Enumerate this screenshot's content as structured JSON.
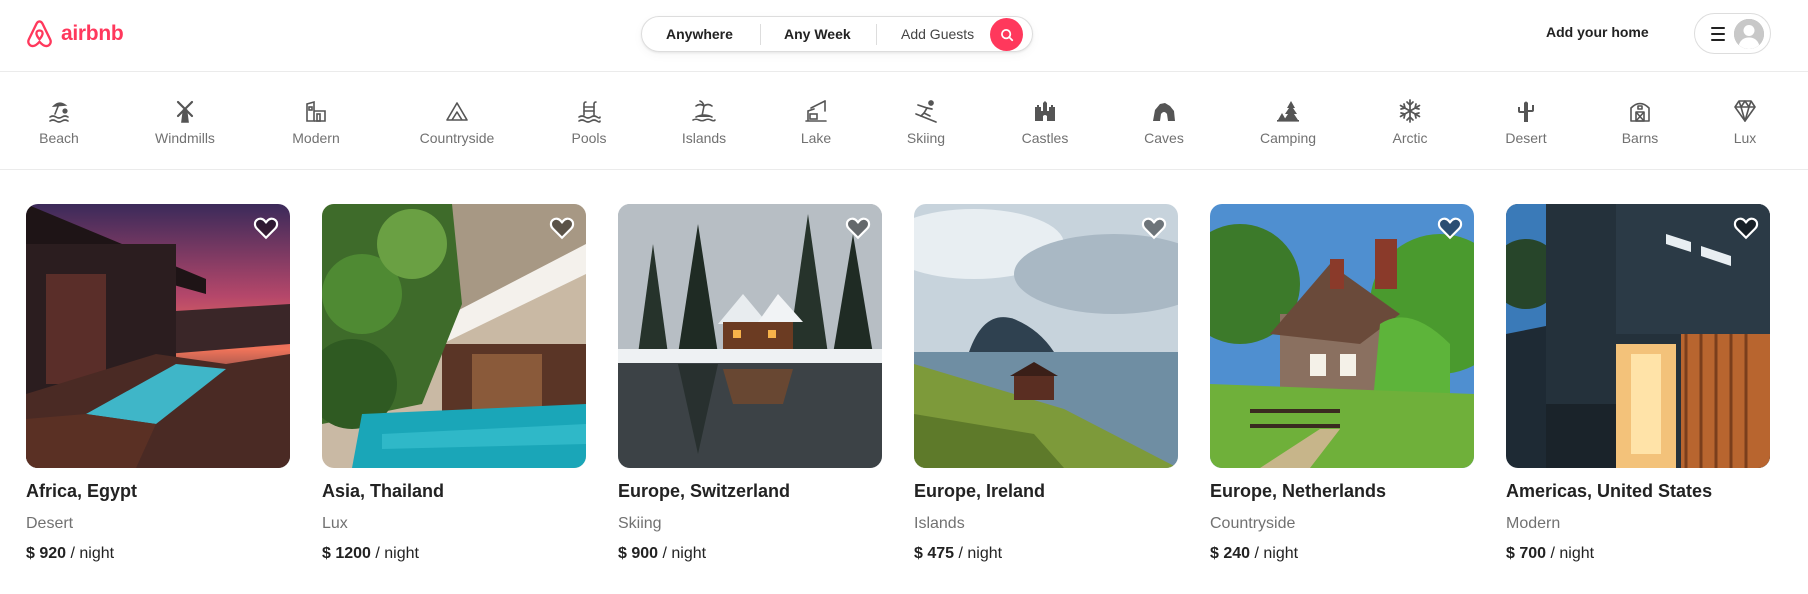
{
  "header": {
    "logo_text": "airbnb",
    "brand_color": "#ff385c",
    "search": {
      "where_label": "Anywhere",
      "when_label": "Any Week",
      "guests_label": "Add Guests",
      "search_icon": "search-icon"
    },
    "host_link": "Add your home",
    "menu_icon": "hamburger-menu-icon",
    "avatar_icon": "user-avatar-icon"
  },
  "categories": [
    {
      "label": "Beach",
      "icon": "beach-icon"
    },
    {
      "label": "Windmills",
      "icon": "windmill-icon"
    },
    {
      "label": "Modern",
      "icon": "modern-house-icon"
    },
    {
      "label": "Countryside",
      "icon": "countryside-icon"
    },
    {
      "label": "Pools",
      "icon": "pool-icon"
    },
    {
      "label": "Islands",
      "icon": "island-icon"
    },
    {
      "label": "Lake",
      "icon": "lake-icon"
    },
    {
      "label": "Skiing",
      "icon": "skiing-icon"
    },
    {
      "label": "Castles",
      "icon": "castle-icon"
    },
    {
      "label": "Caves",
      "icon": "cave-icon"
    },
    {
      "label": "Camping",
      "icon": "camping-icon"
    },
    {
      "label": "Arctic",
      "icon": "snowflake-icon"
    },
    {
      "label": "Desert",
      "icon": "cactus-icon"
    },
    {
      "label": "Barns",
      "icon": "barn-icon"
    },
    {
      "label": "Lux",
      "icon": "diamond-icon"
    }
  ],
  "listings": [
    {
      "location": "Africa, Egypt",
      "category": "Desert",
      "price": "$ 920",
      "unit": " / night"
    },
    {
      "location": "Asia, Thailand",
      "category": "Lux",
      "price": "$ 1200",
      "unit": " / night"
    },
    {
      "location": "Europe, Switzerland",
      "category": "Skiing",
      "price": "$ 900",
      "unit": " / night"
    },
    {
      "location": "Europe, Ireland",
      "category": "Islands",
      "price": "$ 475",
      "unit": " / night"
    },
    {
      "location": "Europe, Netherlands",
      "category": "Countryside",
      "price": "$ 240",
      "unit": " / night"
    },
    {
      "location": "Americas, United States",
      "category": "Modern",
      "price": "$ 700",
      "unit": " / night"
    }
  ]
}
